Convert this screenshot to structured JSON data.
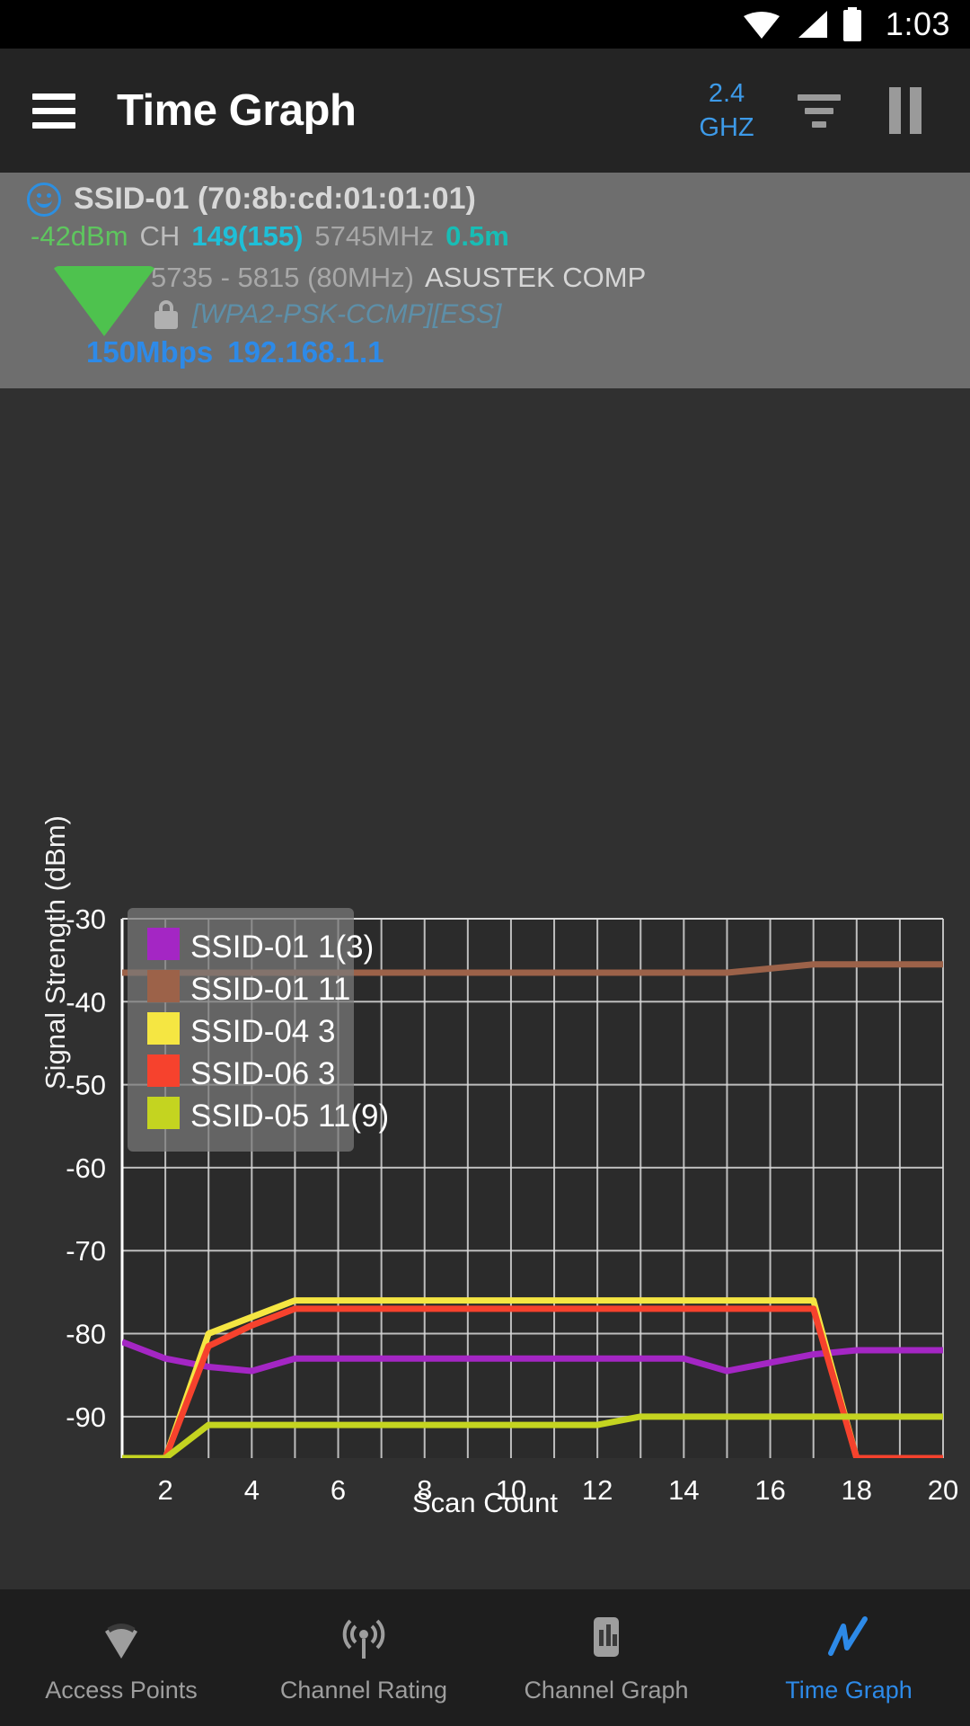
{
  "status_bar": {
    "time": "1:03",
    "icons": [
      "wifi-icon",
      "cellular-signal-icon",
      "battery-icon"
    ]
  },
  "toolbar": {
    "menu_icon": "hamburger-menu-icon",
    "title": "Time Graph",
    "band_line1": "2.4",
    "band_line2": "GHZ",
    "filter_icon": "filter-icon",
    "pause_icon": "pause-icon",
    "accent_color": "#2d8ae8"
  },
  "access_point": {
    "status_icon": "smiley-face-icon",
    "ssid_bssid": "SSID-01 (70:8b:cd:01:01:01)",
    "level": "-42dBm",
    "channel_label": "CH",
    "channel_value": "149(155)",
    "frequency": "5745MHz",
    "distance": "0.5m",
    "freq_range": "5735 - 5815 (80MHz)",
    "vendor": "ASUSTEK COMP",
    "lock_icon": "lock-icon",
    "security": "[WPA2-PSK-CCMP][ESS]",
    "link_speed": "150Mbps",
    "ip_address": "192.168.1.1",
    "signal_wedge_icon": "wifi-strength-wedge-icon",
    "colors": {
      "level": "#5ec65e",
      "channel": "#1ec0d8",
      "distance": "#18bdb5",
      "security": "#5d8fa8",
      "link": "#2d8ae8",
      "wedge": "#4ec24e"
    }
  },
  "chart_data": {
    "type": "line",
    "title": "",
    "xlabel": "Scan Count",
    "ylabel": "Signal Strength (dBm)",
    "xlim": [
      1,
      20
    ],
    "ylim": [
      -95,
      -30
    ],
    "xticks": [
      2,
      4,
      6,
      8,
      10,
      12,
      14,
      16,
      18,
      20
    ],
    "yticks": [
      -30,
      -40,
      -50,
      -60,
      -70,
      -80,
      -90
    ],
    "grid": true,
    "legend_position": "top-left",
    "x": [
      1,
      2,
      3,
      4,
      5,
      6,
      7,
      8,
      9,
      10,
      11,
      12,
      13,
      14,
      15,
      16,
      17,
      18,
      19,
      20
    ],
    "series": [
      {
        "name": "SSID-01 1(3)",
        "color": "#a426c4",
        "values": [
          -81,
          -83,
          -84,
          -84.5,
          -83,
          -83,
          -83,
          -83,
          -83,
          -83,
          -83,
          -83,
          -83,
          -83,
          -84.5,
          -83.5,
          -82.5,
          -82,
          -82,
          -82
        ]
      },
      {
        "name": "SSID-01 11",
        "color": "#9c6249",
        "values": [
          -36.5,
          -36.5,
          -36.5,
          -36.5,
          -36.5,
          -36.5,
          -36.5,
          -36.5,
          -36.5,
          -36.5,
          -36.5,
          -36.5,
          -36.5,
          -36.5,
          -36.5,
          -36,
          -35.5,
          -35.5,
          -35.5,
          -35.5
        ]
      },
      {
        "name": "SSID-04 3",
        "color": "#f5e642",
        "values": [
          -95,
          -95,
          -80,
          -78,
          -76,
          -76,
          -76,
          -76,
          -76,
          -76,
          -76,
          -76,
          -76,
          -76,
          -76,
          -76,
          -76,
          -95,
          -95,
          -95
        ]
      },
      {
        "name": "SSID-06 3",
        "color": "#f6422d",
        "values": [
          -95,
          -95,
          -81.5,
          -79,
          -77,
          -77,
          -77,
          -77,
          -77,
          -77,
          -77,
          -77,
          -77,
          -77,
          -77,
          -77,
          -77,
          -95,
          -95,
          -95
        ]
      },
      {
        "name": "SSID-05 11(9)",
        "color": "#c4d420",
        "values": [
          -95,
          -95,
          -91,
          -91,
          -91,
          -91,
          -91,
          -91,
          -91,
          -91,
          -91,
          -91,
          -90,
          -90,
          -90,
          -90,
          -90,
          -90,
          -90,
          -90
        ]
      }
    ]
  },
  "bottom_nav": {
    "items": [
      {
        "label": "Access Points",
        "icon": "access-point-wedge-icon",
        "active": false
      },
      {
        "label": "Channel Rating",
        "icon": "radar-rating-icon",
        "active": false
      },
      {
        "label": "Channel Graph",
        "icon": "bar-chart-icon",
        "active": false
      },
      {
        "label": "Time Graph",
        "icon": "line-chart-icon",
        "active": true
      }
    ],
    "active_color": "#2d8ae8",
    "inactive_color": "#9e9e9e"
  }
}
